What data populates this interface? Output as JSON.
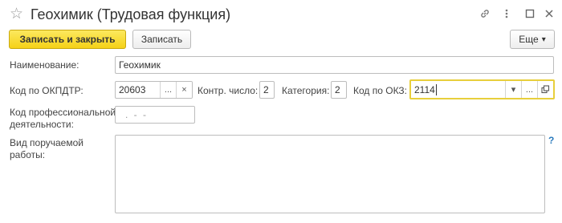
{
  "window": {
    "title": "Геохимик (Трудовая функция)",
    "star_glyph": "☆",
    "icons": [
      "link-icon",
      "more-vertical-icon",
      "maximize-icon",
      "close-icon"
    ]
  },
  "toolbar": {
    "save_close_label": "Записать и закрыть",
    "save_label": "Записать",
    "more_label": "Еще",
    "more_arrow": "▾"
  },
  "form": {
    "name_label": "Наименование:",
    "name_value": "Геохимик",
    "okpdtr_label": "Код по ОКПДТР:",
    "okpdtr_value": "20603",
    "control_label": "Контр. число:",
    "control_value": "2",
    "category_label": "Категория:",
    "category_value": "2",
    "okz_label": "Код по ОКЗ:",
    "okz_value": "2114",
    "prof_label_line1": "Код профессиональной",
    "prof_label_line2": "деятельности:",
    "prof_value": ". - -",
    "work_label_line1": "Вид поручаемой",
    "work_label_line2": "работы:",
    "work_value": "",
    "help_glyph": "?"
  },
  "glyphs": {
    "ellipsis": "...",
    "clear": "×",
    "dropdown": "▾"
  },
  "colors": {
    "primary_button": "#f5d117",
    "focus_border": "#e8cf3c",
    "help": "#2b7bbd"
  }
}
